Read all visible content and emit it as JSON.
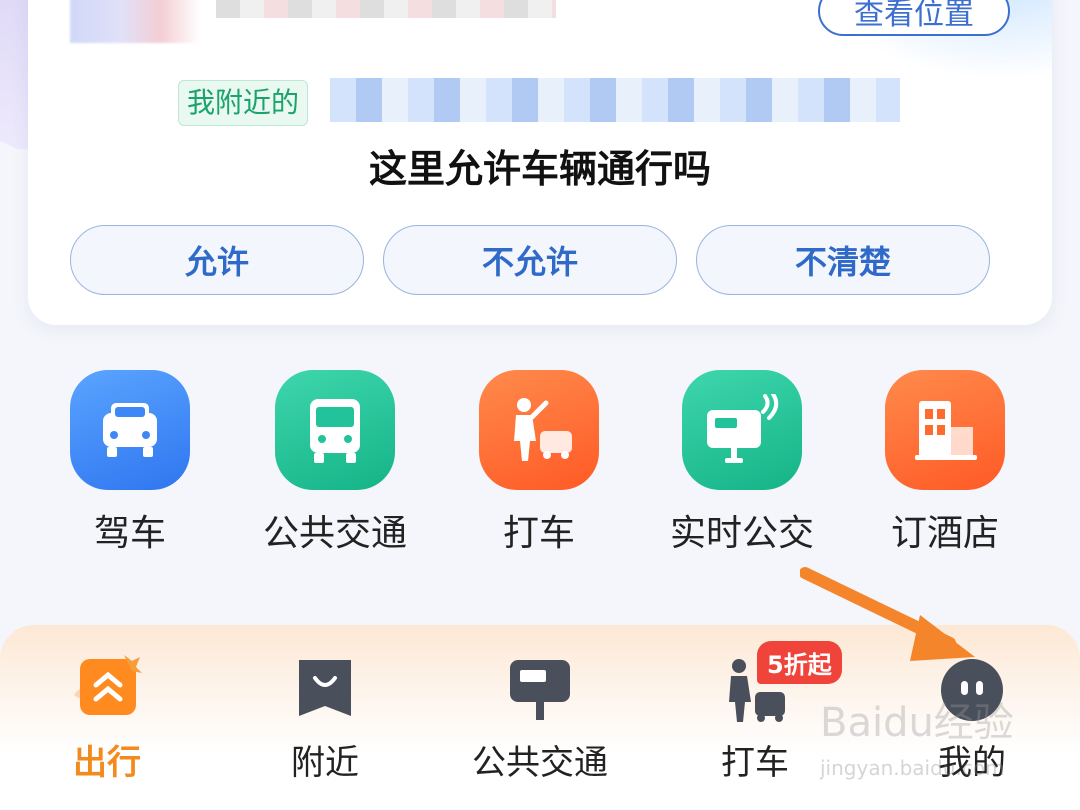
{
  "card": {
    "view_position_label": "查看位置",
    "nearby_tag": "我附近的",
    "question": "这里允许车辆通行吗",
    "options": [
      "允许",
      "不允许",
      "不清楚"
    ]
  },
  "quick_actions": [
    {
      "label": "驾车",
      "icon": "car-icon",
      "color": "#3d88f6"
    },
    {
      "label": "公共交通",
      "icon": "bus-icon",
      "color": "#22c39a"
    },
    {
      "label": "打车",
      "icon": "taxi-icon",
      "color": "#ff6a2e"
    },
    {
      "label": "实时公交",
      "icon": "realtime-bus-icon",
      "color": "#22c39a"
    },
    {
      "label": "订酒店",
      "icon": "hotel-icon",
      "color": "#ff6a2e"
    }
  ],
  "bottom_nav": {
    "tabs": [
      {
        "label": "出行",
        "icon": "travel-icon",
        "active": true
      },
      {
        "label": "附近",
        "icon": "nearby-bag-icon",
        "active": false
      },
      {
        "label": "公共交通",
        "icon": "bus-stop-icon",
        "active": false
      },
      {
        "label": "打车",
        "icon": "taxi-person-icon",
        "active": false
      },
      {
        "label": "我的",
        "icon": "profile-icon",
        "active": false
      }
    ],
    "promo_badge": "5折起"
  },
  "watermark": {
    "logo": "Baidu经验",
    "url": "jingyan.baidu.com"
  },
  "colors": {
    "accent": "#3d6fd0",
    "active_tab": "#f28a1e",
    "arrow": "#f5852a",
    "badge": "#f0443a"
  }
}
